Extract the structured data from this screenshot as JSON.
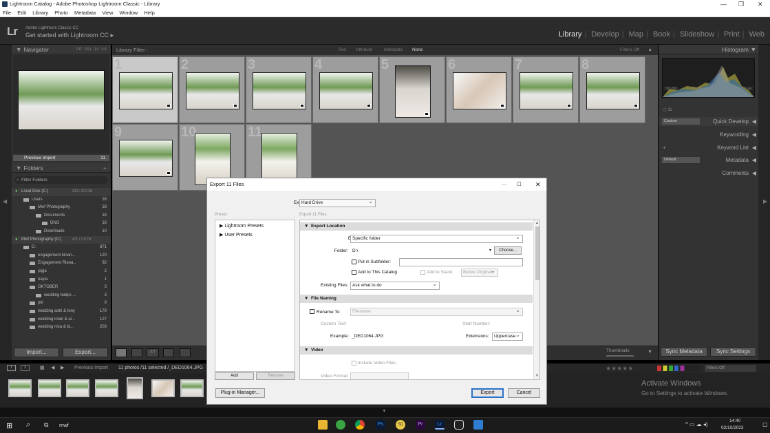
{
  "window": {
    "title": "Lightroom Catalog - Adobe Photoshop Lightroom Classic - Library"
  },
  "menu": [
    "File",
    "Edit",
    "Library",
    "Photo",
    "Metadata",
    "View",
    "Window",
    "Help"
  ],
  "identity": {
    "logo": "Lr",
    "line1": "Adobe Lightroom Classic CC",
    "line2": "Get started with Lightroom CC ▸"
  },
  "modules": [
    "Library",
    "Develop",
    "Map",
    "Book",
    "Slideshow",
    "Print",
    "Web"
  ],
  "left_panel": {
    "navigator": {
      "title": "Navigator",
      "zoom_options": [
        "FIT",
        "FILL",
        "1:1",
        "3:1"
      ]
    },
    "catalog_item": {
      "label": "Previous Import",
      "count": "11"
    },
    "folders": {
      "title": "Folders",
      "filter": "Filter Folders",
      "volumes": [
        {
          "label": "Local Disk (C:)",
          "space": "233 / 223 GB"
        },
        {
          "label": "Mwf Photography (D:)",
          "space": "471 / 1.8 TB"
        }
      ],
      "items": [
        {
          "label": "Users",
          "count": "28",
          "indent": 1
        },
        {
          "label": "Mwf Photography",
          "count": "28",
          "indent": 2
        },
        {
          "label": "Documents",
          "count": "18",
          "indent": 3
        },
        {
          "label": "DNG",
          "count": "18",
          "indent": 4
        },
        {
          "label": "Downloads",
          "count": "10",
          "indent": 3
        },
        {
          "label": "D:",
          "count": "871",
          "indent": 1
        },
        {
          "label": "engagement kinan...",
          "count": "120",
          "indent": 2
        },
        {
          "label": "Engagement Riana...",
          "count": "92",
          "indent": 2
        },
        {
          "label": "jogja",
          "count": "2",
          "indent": 2
        },
        {
          "label": "nayla",
          "count": "1",
          "indent": 2
        },
        {
          "label": "OKTOBER",
          "count": "3",
          "indent": 2
        },
        {
          "label": "wedding balqis ...",
          "count": "3",
          "indent": 3
        },
        {
          "label": "pkl",
          "count": "9",
          "indent": 2
        },
        {
          "label": "wedding astri & tony",
          "count": "179",
          "indent": 2
        },
        {
          "label": "wedding intan & al...",
          "count": "127",
          "indent": 2
        },
        {
          "label": "wedding nisa & bi...",
          "count": "203",
          "indent": 2
        }
      ]
    },
    "import_button": "Import...",
    "export_button": "Export..."
  },
  "filter_bar": {
    "label": "Library Filter :",
    "options": [
      "Text",
      "Attribute",
      "Metadata",
      "None"
    ],
    "filters": "Filters Off"
  },
  "grid": {
    "numbers": [
      "1",
      "2",
      "3",
      "4",
      "5",
      "6",
      "7",
      "8",
      "9",
      "10",
      "11"
    ]
  },
  "toolbar": {
    "thumbnails": "Thumbnails"
  },
  "right_panel": {
    "histogram": {
      "title": "Histogram",
      "info": [
        "ISO 800",
        "50 mm",
        "f / 2.0",
        "1/200 sec"
      ],
      "count": "11"
    },
    "quick_develop": {
      "title": "Quick Develop",
      "preset": "Custom"
    },
    "keywording": "Keywording",
    "keyword_list": "Keyword List",
    "metadata": {
      "title": "Metadata",
      "preset": "Default"
    },
    "comments": "Comments",
    "sync_metadata": "Sync Metadata",
    "sync_settings": "Sync Settings"
  },
  "filmstrip": {
    "source": "Previous Import",
    "status": "11 photos /11 selected /_DED1064.JPG",
    "filters": "Filters Off",
    "views": [
      "1",
      "2"
    ]
  },
  "watermark": {
    "line1": "Activate Windows",
    "line2": "Go to Settings to activate Windows."
  },
  "taskbar": {
    "search": "mwf",
    "time": "14:40",
    "date": "02/10/2023"
  },
  "dialog": {
    "title": "Export 11 Files",
    "export_to_label": "Export To:",
    "export_to_value": "Hard Drive",
    "preset_label": "Preset:",
    "subtitle": "Export 11 Files",
    "presets": [
      "Lightroom Presets",
      "User Presets"
    ],
    "add": "Add",
    "remove": "Remove",
    "plugin_manager": "Plug-in Manager...",
    "export_button": "Export",
    "cancel_button": "Cancel",
    "location": {
      "header": "Export Location",
      "export_to_label": "Export To:",
      "export_to_value": "Specific folder",
      "folder_label": "Folder:",
      "folder_value": "D:\\",
      "choose": "Choose...",
      "subfolder": "Put in Subfolder:",
      "add_catalog": "Add to This Catalog",
      "add_stack": "Add to Stack:",
      "stack_value": "Below Original",
      "existing_label": "Existing Files:",
      "existing_value": "Ask what to do"
    },
    "naming": {
      "header": "File Naming",
      "rename": "Rename To:",
      "rename_value": "Filename",
      "custom_text": "Custom Text:",
      "start_number": "Start Number:",
      "example_label": "Example:",
      "example_value": "_DED1064.JPG",
      "extensions_label": "Extensions:",
      "extensions_value": "Uppercase"
    },
    "video": {
      "header": "Video",
      "include": "Include Video Files:",
      "format": "Video Format:"
    }
  }
}
